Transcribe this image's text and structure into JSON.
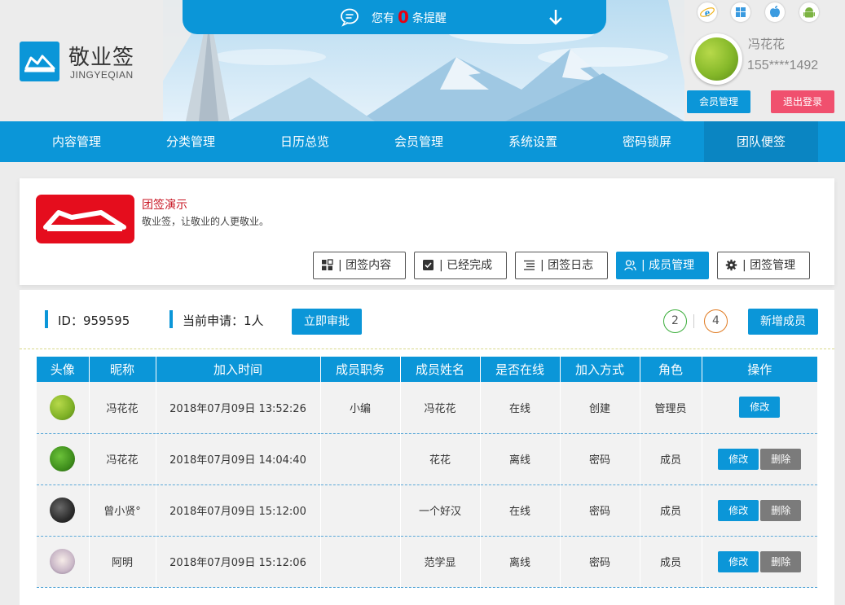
{
  "notice": {
    "prefix": "您有",
    "count": "0",
    "suffix": "条提醒"
  },
  "brand": {
    "name": "敬业签",
    "sub": "JINGYEQIAN"
  },
  "platforms": [
    "ie-icon",
    "windows-icon",
    "apple-icon",
    "android-icon"
  ],
  "user": {
    "name": "冯花花",
    "phone": "155****1492",
    "member_btn": "会员管理",
    "logout_btn": "退出登录"
  },
  "nav": [
    "内容管理",
    "分类管理",
    "日历总览",
    "会员管理",
    "系统设置",
    "密码锁屏",
    "团队便签"
  ],
  "team": {
    "name": "团签演示",
    "desc": "敬业签，让敬业的人更敬业。",
    "tabs": [
      "| 团签内容",
      "| 已经完成",
      "| 团签日志",
      "| 成员管理",
      "| 团签管理"
    ]
  },
  "panel": {
    "id_text": "ID：959595",
    "apply_text": "当前申请：1人",
    "approve_btn": "立即审批",
    "count_a": "2",
    "count_b": "4",
    "add_btn": "新增成员"
  },
  "table": {
    "headers": [
      "头像",
      "昵称",
      "加入时间",
      "成员职务",
      "成员姓名",
      "是否在线",
      "加入方式",
      "角色",
      "操作"
    ],
    "rows": [
      {
        "nick": "冯花花",
        "time": "2018年07月09日 13:52:26",
        "duty": "小编",
        "name": "冯花花",
        "online": "在线",
        "way": "创建",
        "role": "管理员"
      },
      {
        "nick": "冯花花",
        "time": "2018年07月09日 14:04:40",
        "duty": "",
        "name": "花花",
        "online": "离线",
        "way": "密码",
        "role": "成员"
      },
      {
        "nick": "曾小贤°",
        "time": "2018年07月09日 15:12:00",
        "duty": "",
        "name": "一个好汉",
        "online": "在线",
        "way": "密码",
        "role": "成员"
      },
      {
        "nick": "阿明",
        "time": "2018年07月09日 15:12:06",
        "duty": "",
        "name": "范学显",
        "online": "离线",
        "way": "密码",
        "role": "成员"
      }
    ],
    "edit_label": "修改",
    "delete_label": "删除"
  },
  "colors": {
    "primary": "#0b96d8",
    "danger": "#f0506e",
    "team_red": "#e50d1d"
  }
}
